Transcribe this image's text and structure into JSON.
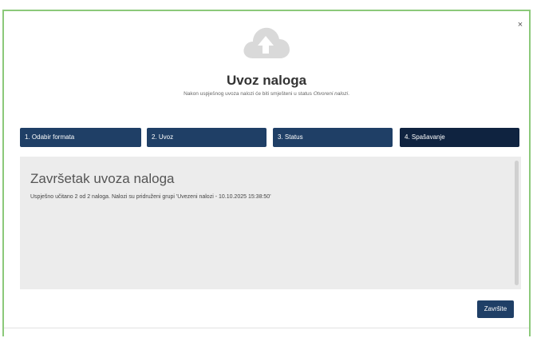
{
  "dialog": {
    "close_label": "×",
    "icon": "cloud-upload-icon",
    "title": "Uvoz naloga",
    "subtitle_prefix": "Nakon uspješnog uvoza nalozi će biti smješteni u status ",
    "subtitle_status": "Otvoreni nalozi",
    "subtitle_suffix": "."
  },
  "steps": [
    {
      "label": "1. Odabir formata"
    },
    {
      "label": "2. Uvoz"
    },
    {
      "label": "3. Status"
    },
    {
      "label": "4. Spašavanje"
    }
  ],
  "panel": {
    "heading": "Završetak uvoza naloga",
    "text": "Uspješno učitano 2 od 2 naloga. Nalozi su pridruženi grupi 'Uvezeni nalozi - 10.10.2025 15:38:50'"
  },
  "footer": {
    "finish_label": "Završite"
  },
  "colors": {
    "accent": "#1f3f66",
    "active_step": "#0f2340",
    "frame_border": "#8cc97a"
  }
}
